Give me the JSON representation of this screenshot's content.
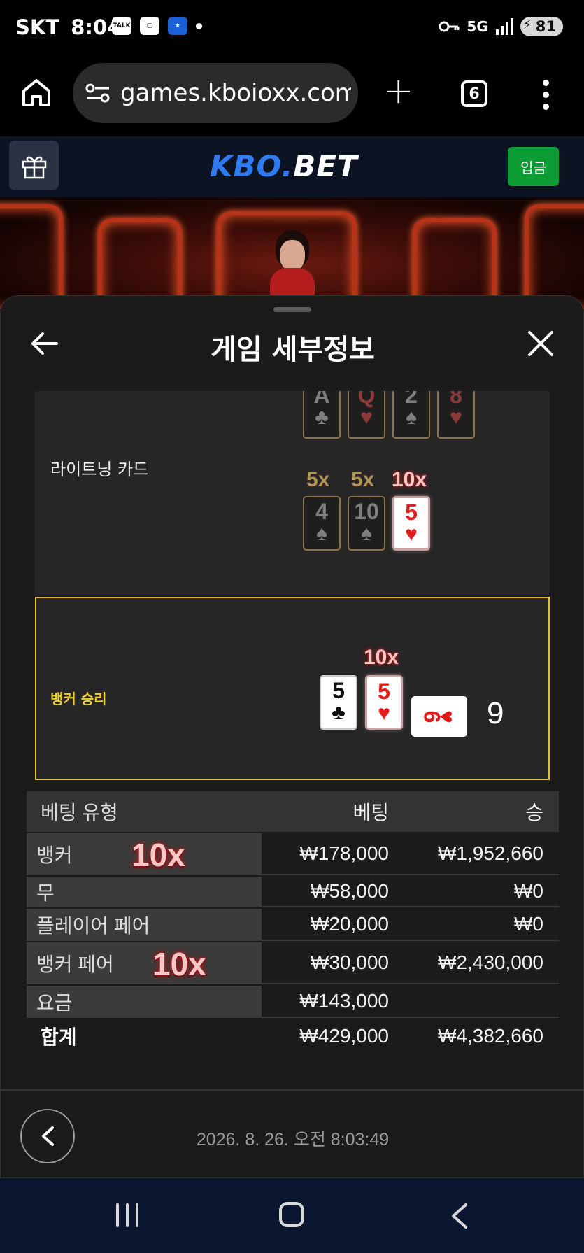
{
  "status_bar": {
    "carrier": "SKT",
    "time": "8:04",
    "network": "5G",
    "battery": "81"
  },
  "browser": {
    "url": "games.kboioxx.com/",
    "tab_count": "6"
  },
  "site": {
    "logo_part1": "KBO.",
    "logo_part2": "BET",
    "deposit_label": "입금"
  },
  "sheet": {
    "title": "게임 세부정보",
    "top_cards": [
      {
        "rank": "A",
        "suit": "♣",
        "color": "dark"
      },
      {
        "rank": "Q",
        "suit": "♥",
        "color": "red"
      },
      {
        "rank": "2",
        "suit": "♠",
        "color": "dark"
      },
      {
        "rank": "8",
        "suit": "♥",
        "color": "red"
      }
    ],
    "lightning": {
      "label": "라이트닝 카드",
      "cards": [
        {
          "multiplier": "5x",
          "rank": "4",
          "suit": "♠",
          "lit": false
        },
        {
          "multiplier": "5x",
          "rank": "10",
          "suit": "♠",
          "lit": false
        },
        {
          "multiplier": "10x",
          "rank": "5",
          "suit": "♥",
          "lit": true
        }
      ]
    },
    "result": {
      "label": "뱅커 승리",
      "multiplier": "10x",
      "cards": [
        {
          "rank": "5",
          "suit": "♣",
          "color": "black"
        },
        {
          "rank": "5",
          "suit": "♥",
          "color": "red",
          "lit": true
        }
      ],
      "third_card": {
        "rank": "6",
        "suit": "♥",
        "orientation": "sideways"
      },
      "score": "9"
    },
    "bets": {
      "headers": [
        "베팅 유형",
        "베팅",
        "승"
      ],
      "rows": [
        {
          "type": "뱅커",
          "multiplier": "10x",
          "bet": "₩178,000",
          "win": "₩1,952,660"
        },
        {
          "type": "무",
          "multiplier": "",
          "bet": "₩58,000",
          "win": "₩0"
        },
        {
          "type": "플레이어 페어",
          "multiplier": "",
          "bet": "₩20,000",
          "win": "₩0"
        },
        {
          "type": "뱅커 페어",
          "multiplier": "10x",
          "bet": "₩30,000",
          "win": "₩2,430,000"
        },
        {
          "type": "요금",
          "multiplier": "",
          "bet": "₩143,000",
          "win": ""
        }
      ],
      "total": {
        "label": "합계",
        "bet": "₩429,000",
        "win": "₩4,382,660"
      }
    },
    "timestamp": "2026. 8. 26. 오전 8:03:49"
  },
  "colors": {
    "brand_blue": "#2f7bf2",
    "deposit_green": "#0e9c35",
    "highlight_yellow": "#e3c12a",
    "card_red": "#e31b1b"
  }
}
